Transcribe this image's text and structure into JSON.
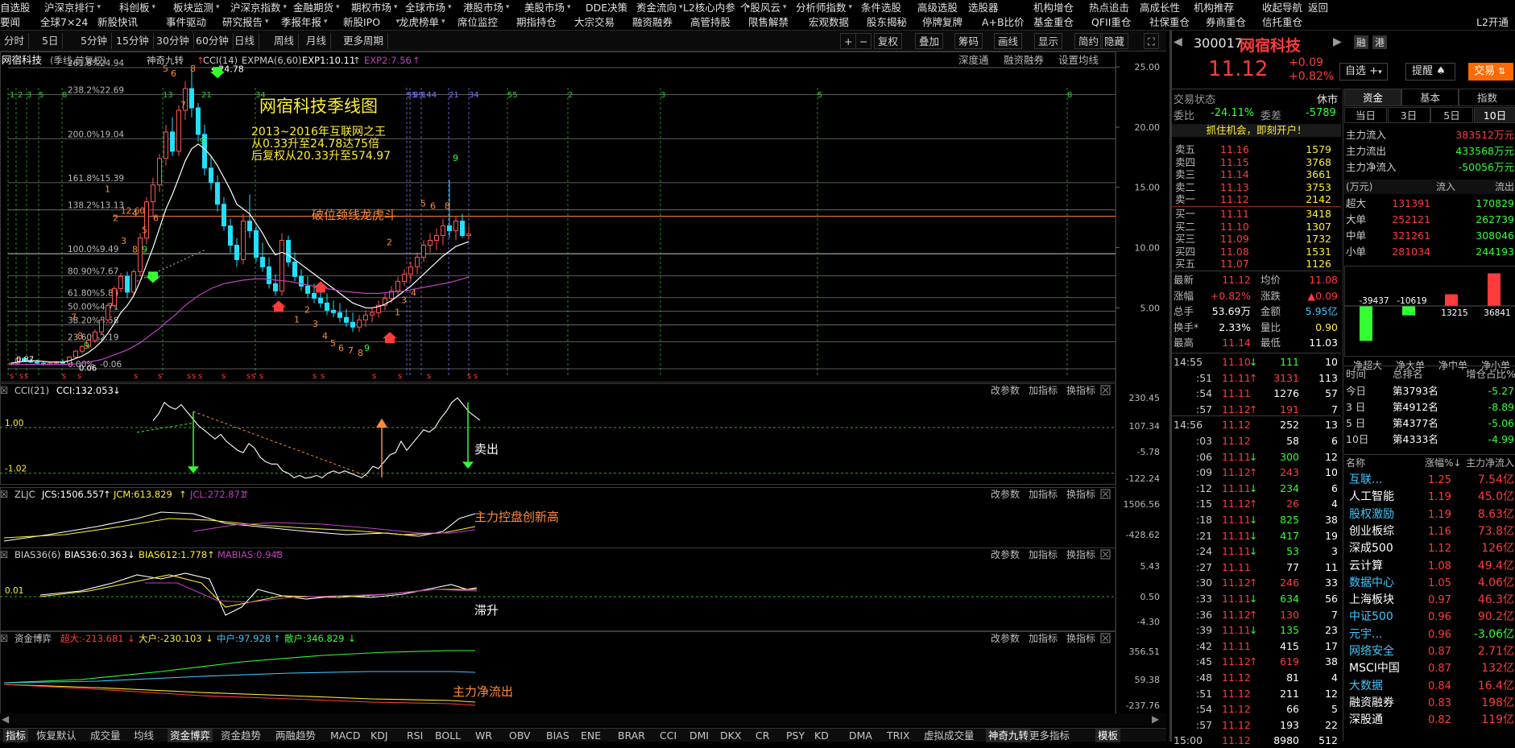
{
  "menu": {
    "row1": [
      "自选股",
      "沪深京排行",
      "科创板",
      "板块监测",
      "沪深京指数",
      "金融期货",
      "期权市场",
      "全球市场",
      "港股市场",
      "美股市场",
      "DDE决策",
      "资金流向",
      "L2核心内参",
      "个股风云",
      "分析师指数",
      "条件选股",
      "高级选股",
      "选股器",
      "机构增仓",
      "热点追击",
      "高成长性",
      "机构推荐",
      "收起导航",
      "返回"
    ],
    "row2": [
      "要闻",
      "全球7×24",
      "新股快讯",
      "事件驱动",
      "研究报告",
      "季报年报",
      "新股IPO",
      "龙虎榜单",
      "席位监控",
      "期指持仓",
      "大宗交易",
      "融资融券",
      "高管持股",
      "限售解禁",
      "宏观数据",
      "股东揭秘",
      "停牌复牌",
      "A+B比价",
      "基金重仓",
      "QFII重仓",
      "社保重仓",
      "券商重仓",
      "信托重仓",
      "L2开通"
    ],
    "arrow_items_row1": [
      1,
      2,
      3,
      4,
      5,
      6,
      7,
      8,
      9,
      10,
      11,
      12,
      13,
      14
    ],
    "arrow_items_row2": [
      4,
      5,
      6,
      7
    ]
  },
  "toolbar": {
    "periods": [
      "分时",
      "5日",
      "5分钟",
      "15分钟",
      "30分钟",
      "60分钟",
      "日线",
      "周线",
      "月线",
      "更多周期"
    ],
    "right": [
      "+",
      "−",
      "复权",
      "叠加",
      "筹码",
      "画线",
      "显示",
      "简约",
      "隐藏"
    ],
    "active": "复权"
  },
  "chart_header": {
    "name": "网宿科技",
    "mode": "(季线,前复权)",
    "indicator1": "神奇九转",
    "cci": "CCI(14)",
    "expma": "EXPMA(6,60)",
    "exp1": "EXP1:10.11",
    "exp2": "EXP2:7.56",
    "links": [
      "深度通",
      "融资融券",
      "设置均线"
    ]
  },
  "annotations": {
    "title": "网宿科技季线图",
    "line1": "2013~2016年互联网之王",
    "line2": "从0.33升至24.78达75倍",
    "line3": "后复权从20.33升至574.97",
    "neck": "破位颈线龙虎斗",
    "sell": "卖出",
    "newhigh": "主力控盘创新高",
    "bias_note": "滞升",
    "outflow": "主力净流出"
  },
  "fib": [
    {
      "pct": "261.8%",
      "val": "24.94"
    },
    {
      "pct": "238.2%",
      "val": "22.69"
    },
    {
      "pct": "200.0%",
      "val": "19.04"
    },
    {
      "pct": "161.8%",
      "val": "15.39"
    },
    {
      "pct": "138.2%",
      "val": "13.13"
    },
    {
      "pct": "100.0%",
      "val": "9.49"
    },
    {
      "pct": "80.90%",
      "val": "7.67"
    },
    {
      "pct": "61.80%",
      "val": "5.84"
    },
    {
      "pct": "50.00%",
      "val": "4.71"
    },
    {
      "pct": "38.20%",
      "val": "3.58"
    },
    {
      "pct": "23.60%",
      "val": "2.19"
    },
    {
      "pct": "0.00%",
      "val": "-0.06"
    }
  ],
  "price_axis": [
    "25.00",
    "20.00",
    "15.00",
    "10.00",
    "5.00"
  ],
  "max_label": "24.78",
  "neck_label": "12.60",
  "left_label": "0.87",
  "left_label2": "0.06",
  "seq_top": [
    "1",
    "2",
    "3",
    "5",
    "8",
    "13",
    "21",
    "34",
    "55",
    "89",
    "144",
    "21",
    "34",
    "55",
    "2",
    "3",
    "5",
    "8",
    "13",
    "21",
    "34",
    "55",
    "89",
    "144"
  ],
  "cci_panel": {
    "name": "CCI(21)",
    "value": "CCI:132.053",
    "ticks": [
      "230.45",
      "107.34",
      "-5.78",
      "-122.24"
    ],
    "lvl_hi": "1.00",
    "lvl_lo": "-1.02"
  },
  "zljc_panel": {
    "name": "ZLJC",
    "jcs": "JCS:1506.557",
    "jcm": "JCM:613.829",
    "jcl": "JCL:272.871",
    "ticks": [
      "1506.56",
      "-428.62"
    ]
  },
  "bias_panel": {
    "name": "BIAS36(6)",
    "b36": "BIAS36:0.363",
    "b612": "BIAS612:1.778",
    "mabias": "MABIAS:0.943",
    "ticks": [
      "5.43",
      "0.50",
      "-4.30"
    ],
    "lvl": "0.01"
  },
  "fund_panel": {
    "name": "资金博弈",
    "big": "超大:-213.681",
    "large": "大户:-230.103",
    "mid": "中户:97.928",
    "small": "散户:346.829",
    "ticks": [
      "356.51",
      "59.38",
      "-237.76"
    ]
  },
  "panel_btns": [
    "改参数",
    "加指标",
    "换指标"
  ],
  "bottom_tabs": [
    "指标",
    "恢复默认",
    "成交量",
    "均线",
    "资金博弈",
    "资金趋势",
    "两融趋势",
    "MACD",
    "KDJ",
    "RSI",
    "BOLL",
    "WR",
    "OBV",
    "BIAS",
    "ENE",
    "BRAR",
    "CCI",
    "DMI",
    "DKX",
    "CR",
    "PSY",
    "KD",
    "DMA",
    "TRIX",
    "虚拟成交量",
    "神奇九转",
    "更多指标",
    "模板"
  ],
  "quote": {
    "code": "300017",
    "name": "网宿科技",
    "tags": [
      "融",
      "港"
    ],
    "price": "11.12",
    "chg": "+0.09",
    "pct": "+0.82%",
    "btn_fav": "自选",
    "btn_alert": "提醒",
    "btn_trade": "交易",
    "status_label": "交易状态",
    "status": "休市",
    "weibi_label": "委比",
    "weibi": "-24.11%",
    "weicha_label": "委差",
    "weicha": "-5789",
    "promo": "抓住机会，即刻开户！",
    "asks": [
      {
        "l": "卖五",
        "p": "11.16",
        "v": "1579"
      },
      {
        "l": "卖四",
        "p": "11.15",
        "v": "3768"
      },
      {
        "l": "卖三",
        "p": "11.14",
        "v": "3661"
      },
      {
        "l": "卖二",
        "p": "11.13",
        "v": "3753"
      },
      {
        "l": "卖一",
        "p": "11.12",
        "v": "2142"
      }
    ],
    "bids": [
      {
        "l": "买一",
        "p": "11.11",
        "v": "3418"
      },
      {
        "l": "买二",
        "p": "11.10",
        "v": "1307"
      },
      {
        "l": "买三",
        "p": "11.09",
        "v": "1732"
      },
      {
        "l": "买四",
        "p": "11.08",
        "v": "1531"
      },
      {
        "l": "买五",
        "p": "11.07",
        "v": "1126"
      }
    ],
    "stats": [
      {
        "a": "最新",
        "av": "11.12",
        "b": "均价",
        "bv": "11.08"
      },
      {
        "a": "涨幅",
        "av": "+0.82%",
        "b": "涨跌",
        "bv": "▲0.09"
      },
      {
        "a": "总手",
        "av": "53.69万",
        "b": "金额",
        "bv": "5.95亿"
      },
      {
        "a": "换手*",
        "av": "2.33%",
        "b": "量比",
        "bv": "0.90"
      },
      {
        "a": "最高",
        "av": "11.14",
        "b": "最低",
        "bv": "11.03"
      }
    ]
  },
  "ticks": [
    {
      "t": "14:55",
      "p": "11.10",
      "d": "down",
      "v": "111",
      "n": "10"
    },
    {
      "t": ":51",
      "p": "11.11",
      "d": "up",
      "v": "3131",
      "n": "113"
    },
    {
      "t": ":54",
      "p": "11.11",
      "d": "",
      "v": "1276",
      "n": "57"
    },
    {
      "t": ":57",
      "p": "11.12",
      "d": "up",
      "v": "191",
      "n": "7"
    },
    {
      "t": "14:56",
      "p": "11.12",
      "d": "",
      "v": "252",
      "n": "13"
    },
    {
      "t": ":03",
      "p": "11.12",
      "d": "",
      "v": "58",
      "n": "6"
    },
    {
      "t": ":06",
      "p": "11.11",
      "d": "down",
      "v": "300",
      "n": "12"
    },
    {
      "t": ":09",
      "p": "11.12",
      "d": "up",
      "v": "243",
      "n": "10"
    },
    {
      "t": ":12",
      "p": "11.11",
      "d": "down",
      "v": "234",
      "n": "6"
    },
    {
      "t": ":15",
      "p": "11.12",
      "d": "up",
      "v": "26",
      "n": "4"
    },
    {
      "t": ":18",
      "p": "11.11",
      "d": "down",
      "v": "825",
      "n": "38"
    },
    {
      "t": ":21",
      "p": "11.11",
      "d": "down",
      "v": "417",
      "n": "19"
    },
    {
      "t": ":24",
      "p": "11.11",
      "d": "down",
      "v": "53",
      "n": "3"
    },
    {
      "t": ":27",
      "p": "11.11",
      "d": "",
      "v": "77",
      "n": "11"
    },
    {
      "t": ":30",
      "p": "11.12",
      "d": "up",
      "v": "246",
      "n": "33"
    },
    {
      "t": ":33",
      "p": "11.11",
      "d": "down",
      "v": "634",
      "n": "56"
    },
    {
      "t": ":36",
      "p": "11.12",
      "d": "up",
      "v": "130",
      "n": "7"
    },
    {
      "t": ":39",
      "p": "11.11",
      "d": "down",
      "v": "135",
      "n": "23"
    },
    {
      "t": ":42",
      "p": "11.11",
      "d": "",
      "v": "415",
      "n": "17"
    },
    {
      "t": ":45",
      "p": "11.12",
      "d": "up",
      "v": "619",
      "n": "38"
    },
    {
      "t": ":48",
      "p": "11.12",
      "d": "",
      "v": "81",
      "n": "4"
    },
    {
      "t": ":51",
      "p": "11.12",
      "d": "",
      "v": "211",
      "n": "12"
    },
    {
      "t": ":54",
      "p": "11.12",
      "d": "",
      "v": "66",
      "n": "5"
    },
    {
      "t": ":57",
      "p": "11.12",
      "d": "",
      "v": "193",
      "n": "22"
    },
    {
      "t": "15:00",
      "p": "11.12",
      "d": "",
      "v": "8980",
      "n": "512"
    }
  ],
  "fund": {
    "tabs": [
      "资金",
      "基本",
      "指数"
    ],
    "periods": [
      "当日",
      "3日",
      "5日",
      "10日"
    ],
    "active_period": "10日",
    "rows": [
      {
        "l": "主力流入",
        "v": "383512万元",
        "c": "red"
      },
      {
        "l": "主力流出",
        "v": "433568万元",
        "c": "green"
      },
      {
        "l": "主力净流入",
        "v": "-50056万元",
        "c": "green"
      }
    ],
    "unit": "(万元)",
    "in_label": "流入",
    "out_label": "流出",
    "table": [
      {
        "l": "超大",
        "i": "131391",
        "o": "170829"
      },
      {
        "l": "大单",
        "i": "252121",
        "o": "262739"
      },
      {
        "l": "中单",
        "i": "321261",
        "o": "308046"
      },
      {
        "l": "小单",
        "i": "281034",
        "o": "244193"
      }
    ],
    "bars": [
      {
        "l": "净超大",
        "v": -39437
      },
      {
        "l": "净大单",
        "v": -10619
      },
      {
        "l": "净中单",
        "v": 13215
      },
      {
        "l": "净小单",
        "v": 36841
      }
    ],
    "bar_labels": [
      "-39437",
      "-10619",
      "13215",
      "36841"
    ],
    "rank_head": [
      "时间",
      "总排名",
      "增仓占比%"
    ],
    "ranks": [
      {
        "t": "今日",
        "r": "第3793名",
        "v": "-5.27"
      },
      {
        "t": "3 日",
        "r": "第4912名",
        "v": "-8.89"
      },
      {
        "t": "5 日",
        "r": "第4377名",
        "v": "-5.06"
      },
      {
        "t": "10日",
        "r": "第4333名",
        "v": "-4.99"
      }
    ],
    "sec_head": [
      "名称",
      "涨幅%↓",
      "主力净流入"
    ],
    "sectors": [
      {
        "n": "互联...",
        "p": "1.25",
        "v": "7.54亿",
        "nc": "cyan",
        "vc": "red"
      },
      {
        "n": "人工智能",
        "p": "1.19",
        "v": "45.0亿",
        "nc": "white",
        "vc": "red"
      },
      {
        "n": "股权激励",
        "p": "1.19",
        "v": "8.63亿",
        "nc": "cyan",
        "vc": "red"
      },
      {
        "n": "创业板综",
        "p": "1.16",
        "v": "73.8亿",
        "nc": "white",
        "vc": "red"
      },
      {
        "n": "深成500",
        "p": "1.12",
        "v": "126亿",
        "nc": "white",
        "vc": "red"
      },
      {
        "n": "云计算",
        "p": "1.08",
        "v": "49.4亿",
        "nc": "white",
        "vc": "red"
      },
      {
        "n": "数据中心",
        "p": "1.05",
        "v": "4.06亿",
        "nc": "cyan",
        "vc": "red"
      },
      {
        "n": "上海板块",
        "p": "0.97",
        "v": "46.3亿",
        "nc": "white",
        "vc": "red"
      },
      {
        "n": "中证500",
        "p": "0.96",
        "v": "90.2亿",
        "nc": "cyan",
        "vc": "red"
      },
      {
        "n": "元宇...",
        "p": "0.96",
        "v": "-3.06亿",
        "nc": "cyan",
        "vc": "green"
      },
      {
        "n": "网络安全",
        "p": "0.87",
        "v": "2.71亿",
        "nc": "cyan",
        "vc": "red"
      },
      {
        "n": "MSCI中国",
        "p": "0.87",
        "v": "132亿",
        "nc": "white",
        "vc": "red"
      },
      {
        "n": "大数据",
        "p": "0.84",
        "v": "16.4亿",
        "nc": "cyan",
        "vc": "red"
      },
      {
        "n": "融资融券",
        "p": "0.83",
        "v": "198亿",
        "nc": "white",
        "vc": "red"
      },
      {
        "n": "深股通",
        "p": "0.82",
        "v": "119亿",
        "nc": "white",
        "vc": "red"
      }
    ]
  },
  "colors": {
    "up": "#ff3b3b",
    "down": "#33ff33",
    "cyan": "#3ec8ff",
    "yellow": "#ffee33",
    "magenta": "#c040c0"
  }
}
